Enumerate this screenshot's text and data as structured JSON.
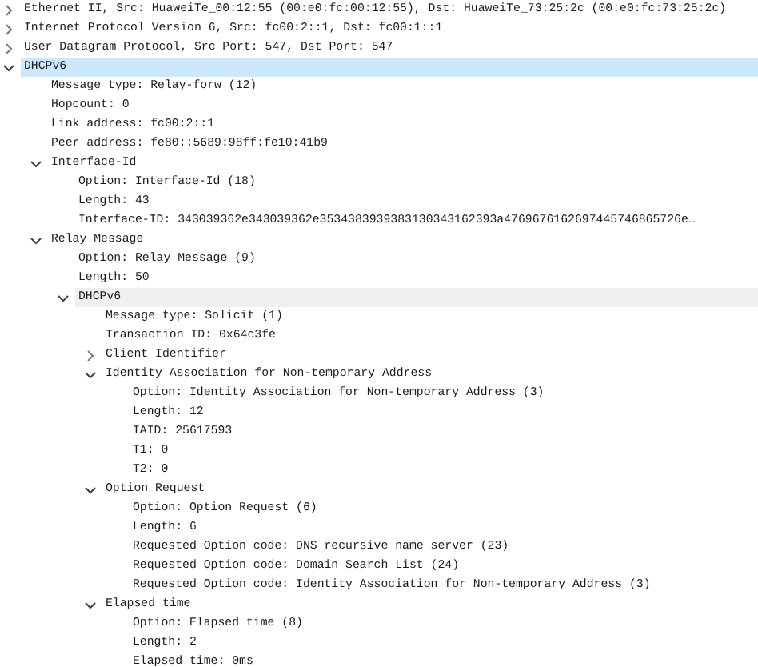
{
  "packet_details": [
    {
      "text": "Ethernet II, Src: HuaweiTe_00:12:55 (00:e0:fc:00:12:55), Dst: HuaweiTe_73:25:2c (00:e0:fc:73:25:2c)",
      "expanded": false,
      "selected": false,
      "hovered": false
    },
    {
      "text": "Internet Protocol Version 6, Src: fc00:2::1, Dst: fc00:1::1",
      "expanded": false,
      "selected": false,
      "hovered": false
    },
    {
      "text": "User Datagram Protocol, Src Port: 547, Dst Port: 547",
      "expanded": false,
      "selected": false,
      "hovered": false
    },
    {
      "text": "DHCPv6",
      "expanded": true,
      "selected": true,
      "hovered": false,
      "children": [
        {
          "text": "Message type: Relay-forw (12)",
          "selected": false,
          "hovered": false
        },
        {
          "text": "Hopcount: 0",
          "selected": false,
          "hovered": false
        },
        {
          "text": "Link address: fc00:2::1",
          "selected": false,
          "hovered": false
        },
        {
          "text": "Peer address: fe80::5689:98ff:fe10:41b9",
          "selected": false,
          "hovered": false
        },
        {
          "text": "Interface-Id",
          "expanded": true,
          "selected": false,
          "hovered": false,
          "children": [
            {
              "text": "Option: Interface-Id (18)",
              "selected": false,
              "hovered": false
            },
            {
              "text": "Length: 43",
              "selected": false,
              "hovered": false
            },
            {
              "text": "Interface-ID: 343039362e343039362e3534383939383130343162393a4769676162697445746865726e…",
              "selected": false,
              "hovered": false
            }
          ]
        },
        {
          "text": "Relay Message",
          "expanded": true,
          "selected": false,
          "hovered": false,
          "children": [
            {
              "text": "Option: Relay Message (9)",
              "selected": false,
              "hovered": false
            },
            {
              "text": "Length: 50",
              "selected": false,
              "hovered": false
            },
            {
              "text": "DHCPv6",
              "expanded": true,
              "selected": false,
              "hovered": true,
              "children": [
                {
                  "text": "Message type: Solicit (1)",
                  "selected": false,
                  "hovered": false
                },
                {
                  "text": "Transaction ID: 0x64c3fe",
                  "selected": false,
                  "hovered": false
                },
                {
                  "text": "Client Identifier",
                  "expanded": false,
                  "selected": false,
                  "hovered": false
                },
                {
                  "text": "Identity Association for Non-temporary Address",
                  "expanded": true,
                  "selected": false,
                  "hovered": false,
                  "children": [
                    {
                      "text": "Option: Identity Association for Non-temporary Address (3)",
                      "selected": false,
                      "hovered": false
                    },
                    {
                      "text": "Length: 12",
                      "selected": false,
                      "hovered": false
                    },
                    {
                      "text": "IAID: 25617593",
                      "selected": false,
                      "hovered": false
                    },
                    {
                      "text": "T1: 0",
                      "selected": false,
                      "hovered": false
                    },
                    {
                      "text": "T2: 0",
                      "selected": false,
                      "hovered": false
                    }
                  ]
                },
                {
                  "text": "Option Request",
                  "expanded": true,
                  "selected": false,
                  "hovered": false,
                  "children": [
                    {
                      "text": "Option: Option Request (6)",
                      "selected": false,
                      "hovered": false
                    },
                    {
                      "text": "Length: 6",
                      "selected": false,
                      "hovered": false
                    },
                    {
                      "text": "Requested Option code: DNS recursive name server (23)",
                      "selected": false,
                      "hovered": false
                    },
                    {
                      "text": "Requested Option code: Domain Search List (24)",
                      "selected": false,
                      "hovered": false
                    },
                    {
                      "text": "Requested Option code: Identity Association for Non-temporary Address (3)",
                      "selected": false,
                      "hovered": false
                    }
                  ]
                },
                {
                  "text": "Elapsed time",
                  "expanded": true,
                  "selected": false,
                  "hovered": false,
                  "children": [
                    {
                      "text": "Option: Elapsed time (8)",
                      "selected": false,
                      "hovered": false
                    },
                    {
                      "text": "Length: 2",
                      "selected": false,
                      "hovered": false
                    },
                    {
                      "text": "Elapsed time: 0ms",
                      "selected": false,
                      "hovered": false
                    }
                  ]
                }
              ]
            }
          ]
        }
      ]
    }
  ]
}
